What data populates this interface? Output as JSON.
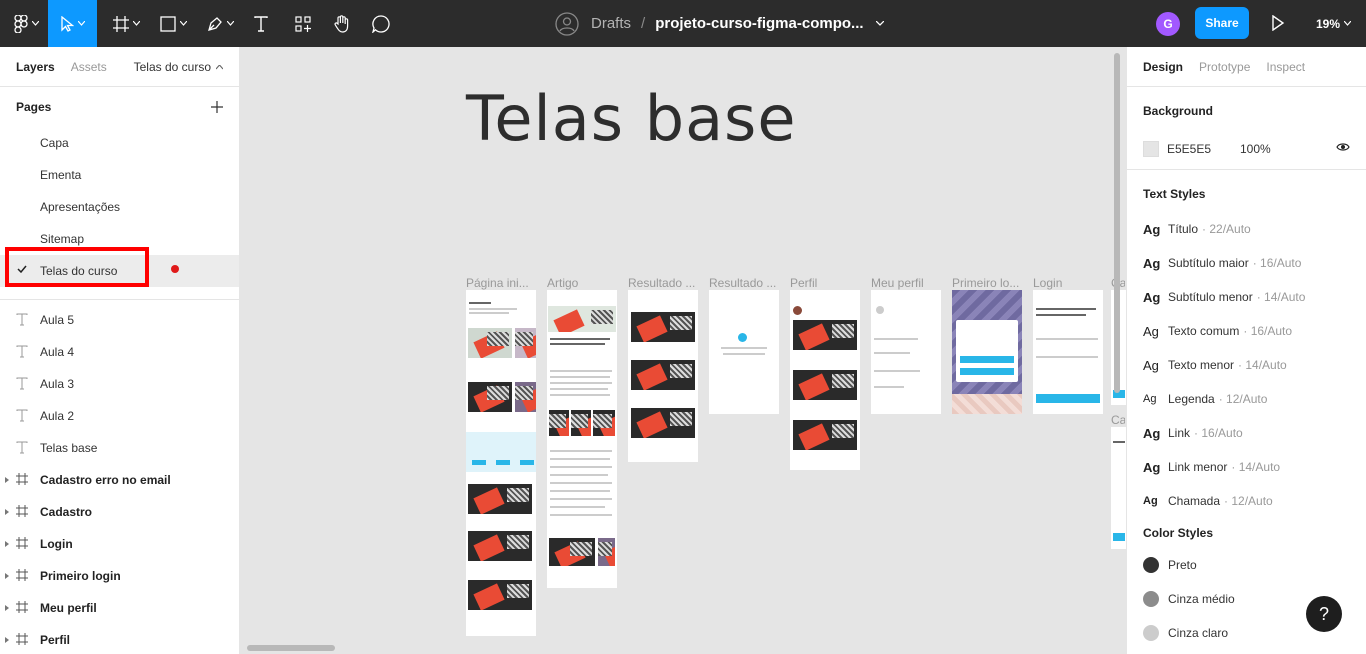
{
  "toolbar": {
    "breadcrumb_project": "Drafts",
    "breadcrumb_sep": "/",
    "file_name": "projeto-curso-figma-compo...",
    "avatar_initial": "G",
    "share_label": "Share",
    "zoom": "19%",
    "tools": [
      "figma-menu-icon",
      "move-tool-icon",
      "frame-tool-icon",
      "shape-tool-icon",
      "pen-tool-icon",
      "text-tool-icon",
      "components-icon",
      "hand-tool-icon",
      "comment-icon"
    ]
  },
  "left_panel": {
    "tabs": [
      "Layers",
      "Assets"
    ],
    "current_page": "Telas do curso",
    "pages_header": "Pages",
    "pages": [
      "Capa",
      "Ementa",
      "Apresentações",
      "Sitemap",
      "Telas do curso"
    ],
    "selected_page": "Telas do curso",
    "layers": [
      {
        "name": "Aula 5",
        "type": "text"
      },
      {
        "name": "Aula 4",
        "type": "text"
      },
      {
        "name": "Aula 3",
        "type": "text"
      },
      {
        "name": "Aula 2",
        "type": "text"
      },
      {
        "name": "Telas base",
        "type": "text"
      },
      {
        "name": "Cadastro erro no email",
        "type": "frame"
      },
      {
        "name": "Cadastro",
        "type": "frame"
      },
      {
        "name": "Login",
        "type": "frame"
      },
      {
        "name": "Primeiro login",
        "type": "frame"
      },
      {
        "name": "Meu perfil",
        "type": "frame"
      },
      {
        "name": "Perfil",
        "type": "frame"
      }
    ]
  },
  "canvas": {
    "title": "Telas base",
    "frames": [
      "Página ini...",
      "Artigo",
      "Resultado ...",
      "Resultado ...",
      "Perfil",
      "Meu perfil",
      "Primeiro lo...",
      "Login",
      "Ca",
      "Ca"
    ]
  },
  "right_panel": {
    "tabs": [
      "Design",
      "Prototype",
      "Inspect"
    ],
    "background_header": "Background",
    "background_hex": "E5E5E5",
    "background_opacity": "100%",
    "text_styles_header": "Text Styles",
    "text_styles": [
      {
        "name": "Título",
        "meta": "· 22/Auto"
      },
      {
        "name": "Subtítulo maior",
        "meta": "· 16/Auto"
      },
      {
        "name": "Subtítulo menor",
        "meta": "· 14/Auto"
      },
      {
        "name": "Texto comum",
        "meta": "· 16/Auto"
      },
      {
        "name": "Texto menor",
        "meta": "· 14/Auto"
      },
      {
        "name": "Legenda",
        "meta": "· 12/Auto"
      },
      {
        "name": "Link",
        "meta": "· 16/Auto"
      },
      {
        "name": "Link menor",
        "meta": "· 14/Auto"
      },
      {
        "name": "Chamada",
        "meta": "· 12/Auto"
      }
    ],
    "color_styles_header": "Color Styles",
    "color_styles": [
      {
        "name": "Preto",
        "color": "#333333"
      },
      {
        "name": "Cinza médio",
        "color": "#8c8c8c"
      },
      {
        "name": "Cinza claro",
        "color": "#cccccc"
      }
    ]
  },
  "help_label": "?"
}
